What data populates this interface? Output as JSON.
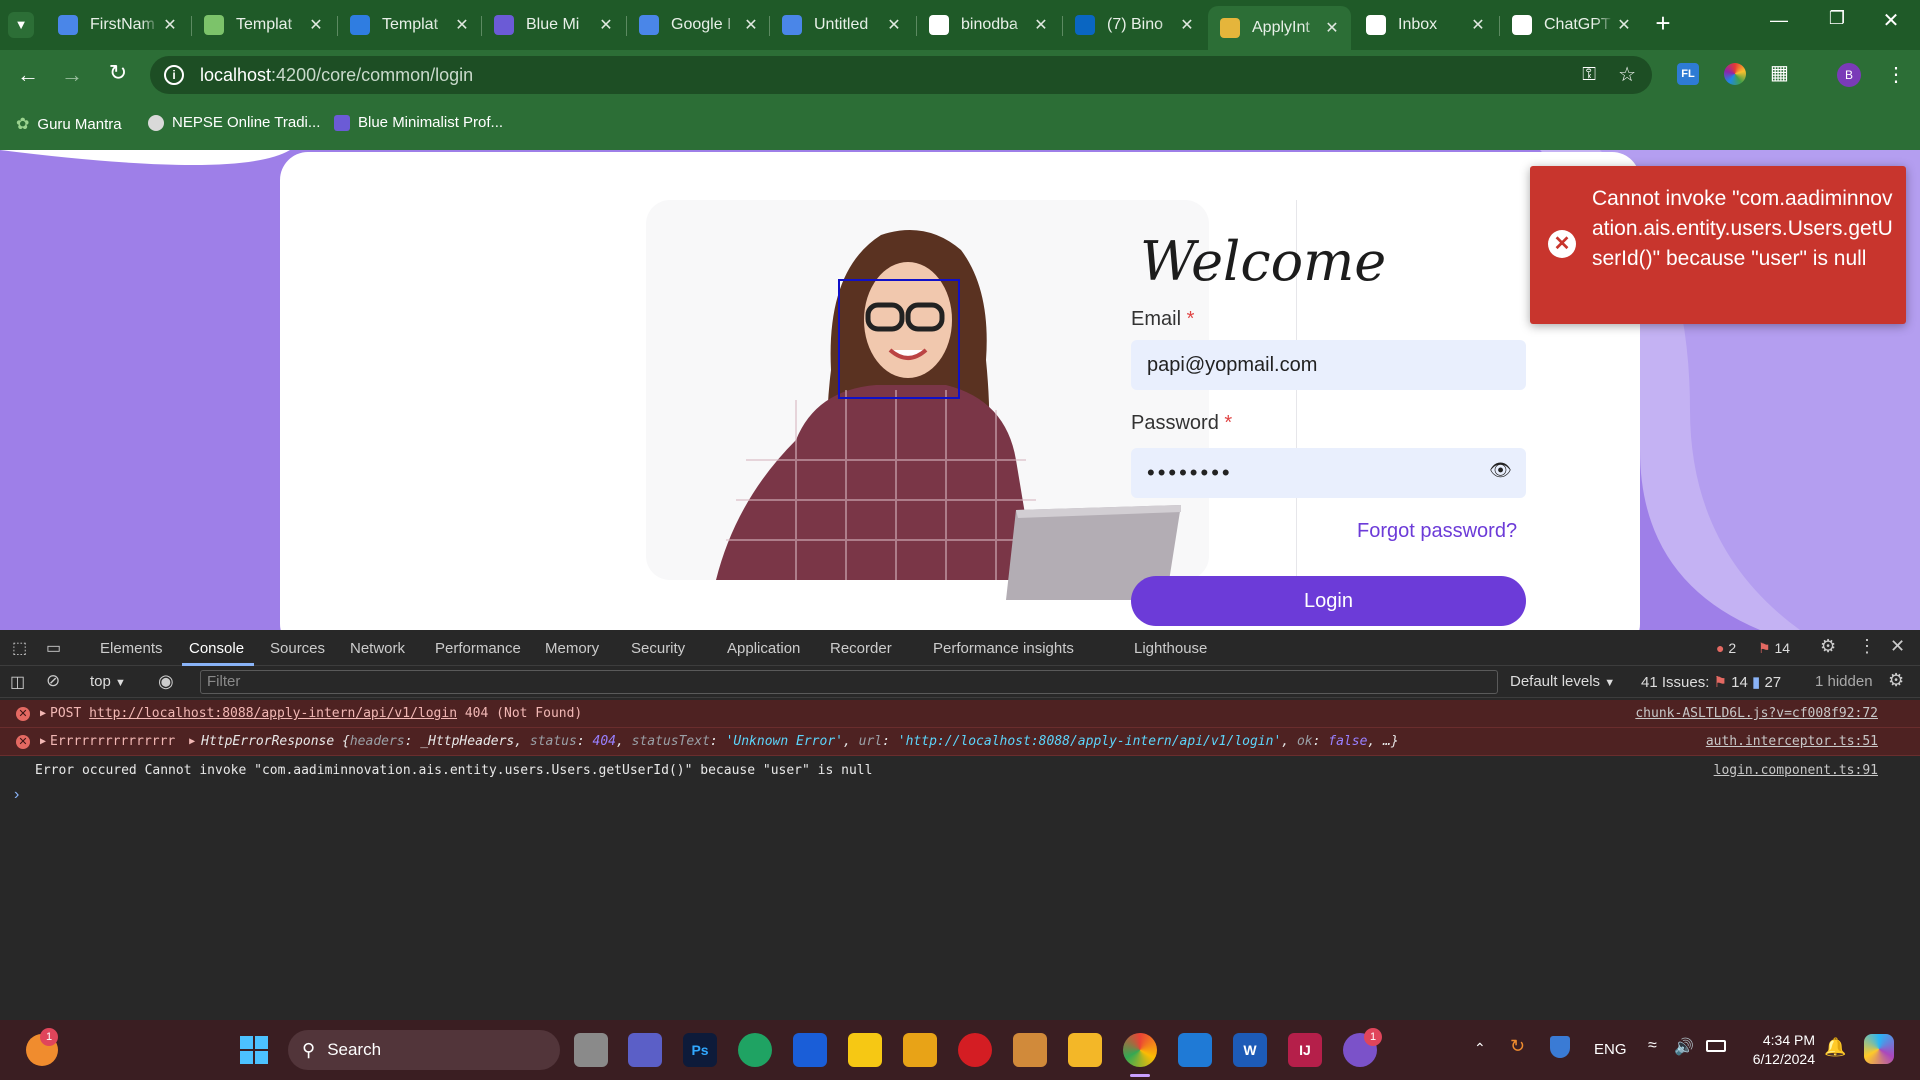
{
  "browser": {
    "tabs": [
      {
        "title": "FirstNam",
        "icon": "google-docs-icon",
        "color": "#4a86e8"
      },
      {
        "title": "Templat",
        "icon": "leaf-icon",
        "color": "#7cc36a"
      },
      {
        "title": "Templat",
        "icon": "c-logo-icon",
        "color": "#2f7de1"
      },
      {
        "title": "Blue Mi",
        "icon": "book-icon",
        "color": "#6b5bd6"
      },
      {
        "title": "Google I",
        "icon": "google-docs-icon",
        "color": "#4a86e8"
      },
      {
        "title": "Untitled",
        "icon": "google-docs-icon",
        "color": "#4a86e8"
      },
      {
        "title": "binodba",
        "icon": "github-icon",
        "color": "#ffffff"
      },
      {
        "title": "(7) Bino",
        "icon": "linkedin-icon",
        "color": "#0a66c2"
      },
      {
        "title": "ApplyInt",
        "icon": "shield-logo-icon",
        "color": "#e5b53b"
      },
      {
        "title": "Inbox",
        "icon": "yahoo-icon",
        "color": "#ffffff"
      },
      {
        "title": "ChatGPT",
        "icon": "openai-icon",
        "color": "#ffffff"
      }
    ],
    "active_tab_index": 8,
    "address_host": "localhost",
    "address_path": ":4200/core/common/login",
    "bookmarks": [
      {
        "label": "Guru Mantra",
        "icon": "leaf-icon"
      },
      {
        "label": "NEPSE Online Tradi...",
        "icon": "globe-icon"
      },
      {
        "label": "Blue Minimalist Prof...",
        "icon": "book-icon"
      }
    ],
    "profile_initial": "B"
  },
  "login": {
    "welcome": "Welcome",
    "email_label": "Email",
    "email_value": "papi@yopmail.com",
    "password_label": "Password",
    "password_mask": "••••••••",
    "required_mark": "*",
    "forgot": "Forgot password?",
    "login_button": "Login"
  },
  "toast": {
    "message": "Cannot invoke \"com.aadiminnovation.ais.entity.users.Users.getUserId()\" because \"user\" is null"
  },
  "devtools": {
    "tabs": [
      "Elements",
      "Console",
      "Sources",
      "Network",
      "Performance",
      "Memory",
      "Security",
      "Application",
      "Recorder",
      "Performance insights",
      "Lighthouse"
    ],
    "active_tab": "Console",
    "error_count": "2",
    "warning_count": "14",
    "context": "top",
    "filter_placeholder": "Filter",
    "levels": "Default levels",
    "issues_label": "41 Issues:",
    "issues_errors": "14",
    "issues_info": "27",
    "hidden": "1 hidden",
    "logs": [
      {
        "prefix": "POST ",
        "url": "http://localhost:8088/apply-intern/api/v1/login",
        "suffix": " 404 (Not Found)",
        "source": "chunk-ASLTLD6L.js?v=cf008f92:72"
      },
      {
        "prefix": "Errrrrrrrrrrrrrr ",
        "type": "HttpErrorResponse",
        "body_open": "{",
        "k1": "headers",
        "v1": "_HttpHeaders",
        "k2": "status",
        "v2": "404",
        "k3": "statusText",
        "v3": "'Unknown Error'",
        "k4": "url",
        "v4": "'http://localhost:8088/apply-intern/api/v1/login'",
        "k5": "ok",
        "v5": "false",
        "body_close": ", …}",
        "source": "auth.interceptor.ts:51"
      },
      {
        "text": "Error occured Cannot invoke \"com.aadiminnovation.ais.entity.users.Users.getUserId()\" because \"user\" is null",
        "source": "login.component.ts:91"
      }
    ],
    "prompt": "›"
  },
  "taskbar": {
    "search": "Search",
    "lang": "ENG",
    "time": "4:34 PM",
    "date": "6/12/2024",
    "badge": "1",
    "chat_badge": "1"
  }
}
